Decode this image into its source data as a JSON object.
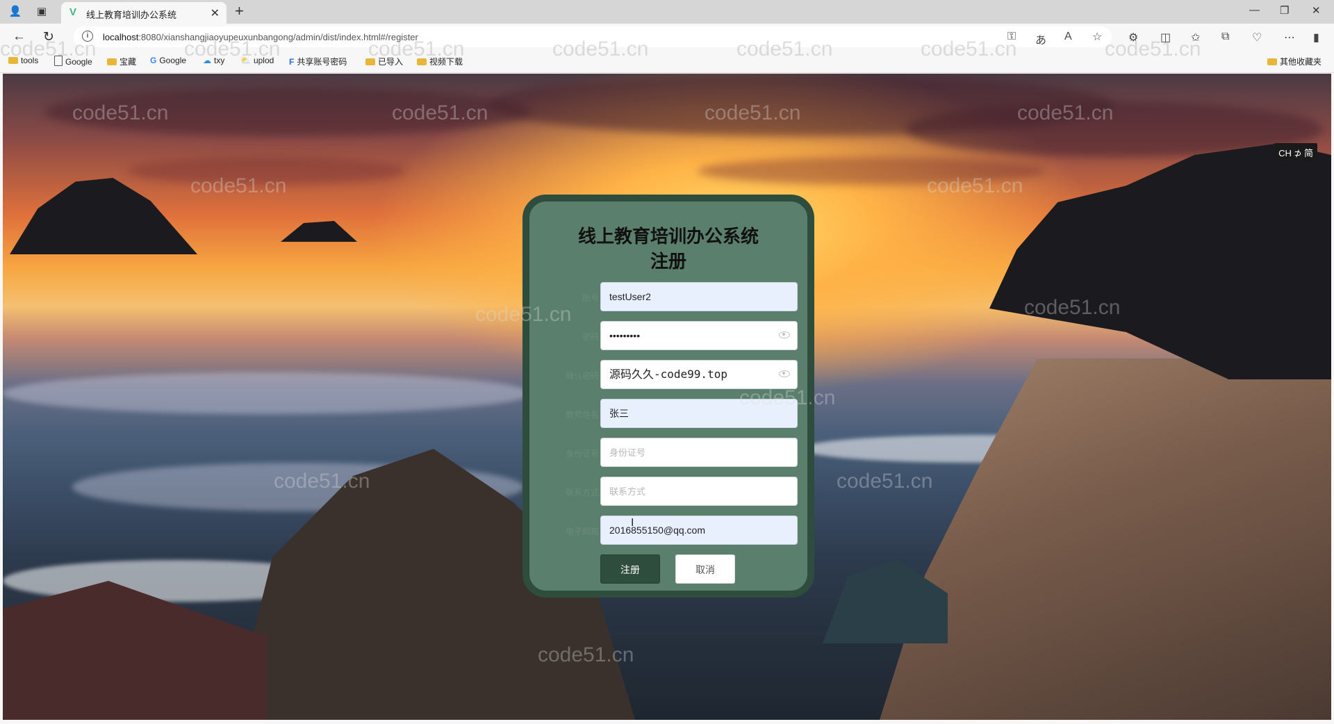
{
  "browser": {
    "tab_title": "线上教育培训办公系统",
    "url_host": "localhost",
    "url_rest": ":8080/xianshangjiaoyupeuxunbangong/admin/dist/index.html#/register"
  },
  "bookmarks": {
    "items": [
      "tools",
      "Google",
      "宝藏",
      "Google",
      "txy",
      "uplod",
      "共享账号密码",
      "已导入",
      "视频下载"
    ],
    "other": "其他收藏夹"
  },
  "ime": "CH ⊅ 简",
  "form": {
    "title_line1": "线上教育培训办公系统",
    "title_line2": "注册",
    "fields": [
      {
        "label": "账号",
        "value": "testUser2"
      },
      {
        "label": "密码",
        "value": "•••••••••"
      },
      {
        "label": "确认密码",
        "value": "源码久久-code99.top"
      },
      {
        "label": "教师姓名",
        "value": "张三"
      },
      {
        "label": "身份证号",
        "placeholder": "身份证号"
      },
      {
        "label": "联系方式",
        "placeholder": "联系方式"
      },
      {
        "label": "电子邮箱",
        "value": "2016855150@qq.com"
      }
    ],
    "register_button": "注册",
    "cancel_button": "取消"
  },
  "watermark": "code51.cn",
  "colors": {
    "card_bg": "#5b7f6d",
    "card_border": "#2f4d3c",
    "primary_button": "#2f4d3c"
  }
}
